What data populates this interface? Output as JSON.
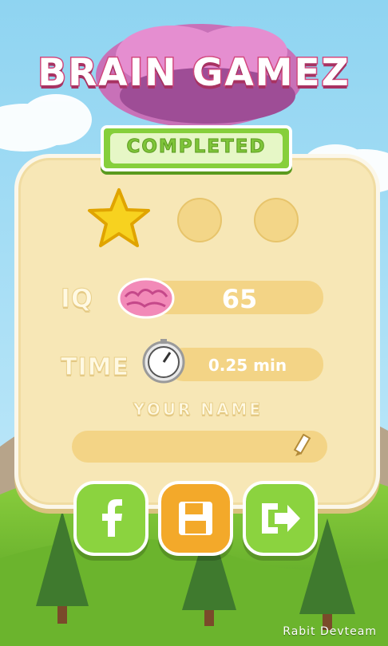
{
  "title": "BRAIN GAMEZ",
  "banner": "COMPLETED",
  "stars": {
    "earned": 1,
    "total": 3
  },
  "iq": {
    "label": "IQ",
    "value": "65",
    "icon": "brain-icon"
  },
  "time": {
    "label": "TIME",
    "value": "0.25 min",
    "icon": "stopwatch-icon"
  },
  "name": {
    "label": "YOUR NAME",
    "value": "",
    "icon": "pencil-icon"
  },
  "buttons": {
    "facebook": "f",
    "save": "save-icon",
    "exit": "exit-icon"
  },
  "credit": "Rabit Devteam",
  "colors": {
    "sky": "#8fd4f1",
    "grass": "#7cc43a",
    "panel": "#f7e7b6",
    "accent_green": "#86cf3b",
    "accent_orange": "#f3a92a",
    "title_pink": "#d2487e"
  }
}
